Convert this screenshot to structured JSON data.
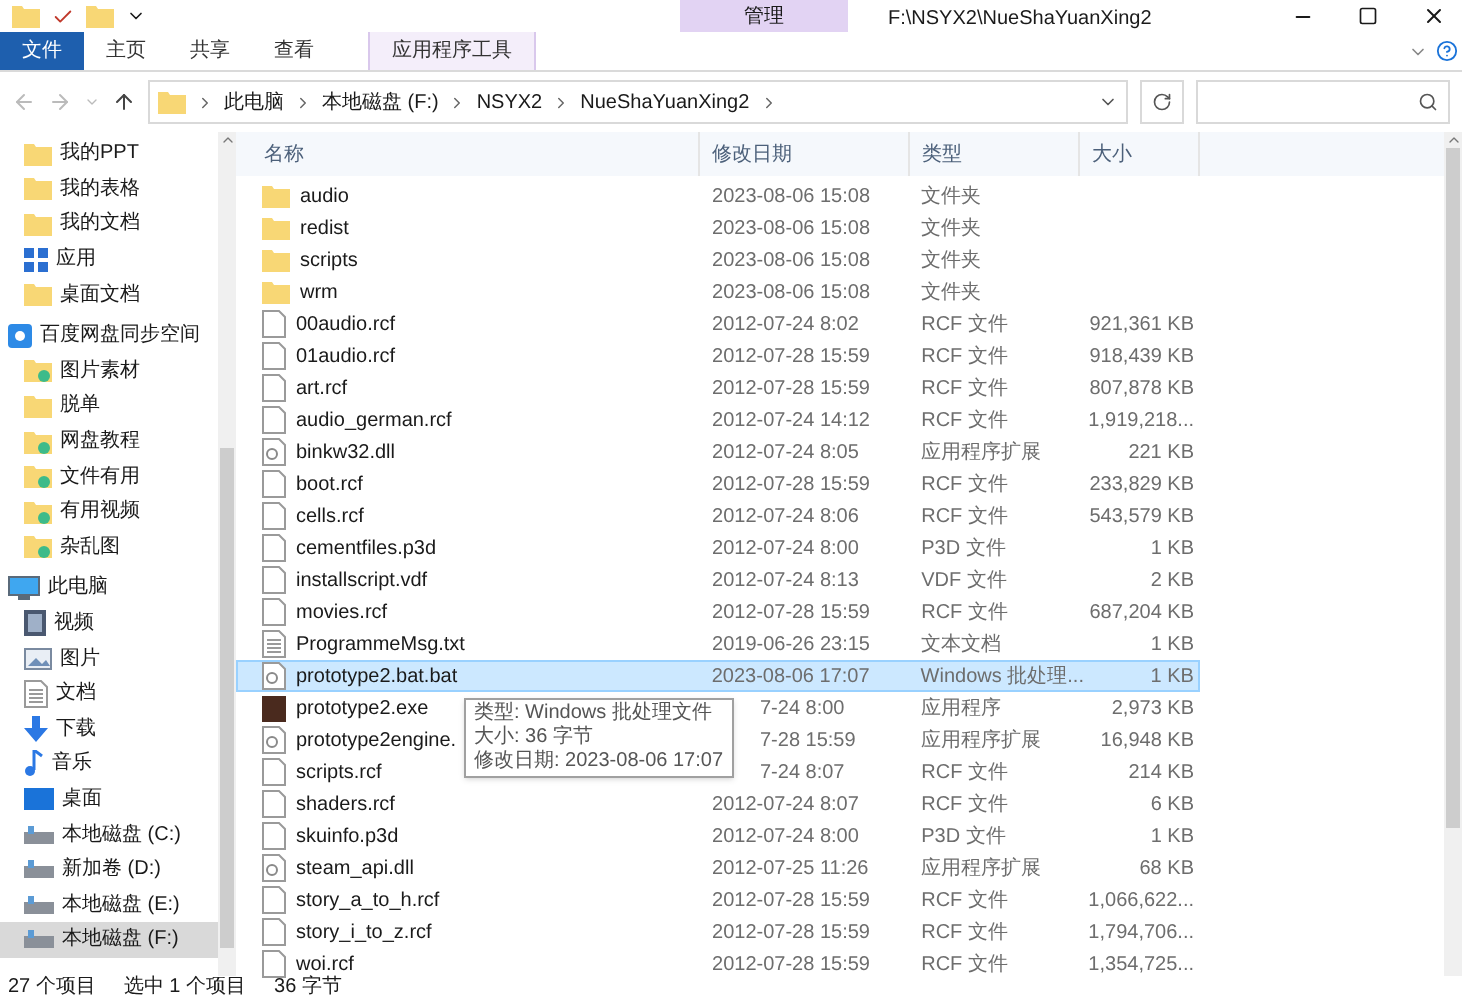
{
  "title_bar": {
    "context_tab": "管理",
    "title": "F:\\NSYX2\\NueShaYuanXing2"
  },
  "ribbon_tabs": [
    {
      "label": "文件",
      "kind": "file"
    },
    {
      "label": "主页",
      "kind": "plain"
    },
    {
      "label": "共享",
      "kind": "plain"
    },
    {
      "label": "查看",
      "kind": "plain"
    },
    {
      "label": "应用程序工具",
      "kind": "context"
    }
  ],
  "breadcrumb": [
    "此电脑",
    "本地磁盘 (F:)",
    "NSYX2",
    "NueShaYuanXing2"
  ],
  "sidebar": {
    "items": [
      {
        "label": "我的PPT",
        "kind": "folder",
        "selected": false
      },
      {
        "label": "我的表格",
        "kind": "folder",
        "selected": false
      },
      {
        "label": "我的文档",
        "kind": "folder",
        "selected": false
      },
      {
        "label": "应用",
        "kind": "apps",
        "selected": false
      },
      {
        "label": "桌面文档",
        "kind": "folder",
        "selected": false
      },
      {
        "label": "百度网盘同步空间",
        "kind": "cloud",
        "selected": false
      },
      {
        "label": "图片素材",
        "kind": "synced",
        "selected": false
      },
      {
        "label": "脱单",
        "kind": "folder",
        "selected": false
      },
      {
        "label": "网盘教程",
        "kind": "synced",
        "selected": false
      },
      {
        "label": "文件有用",
        "kind": "synced",
        "selected": false
      },
      {
        "label": "有用视频",
        "kind": "synced",
        "selected": false
      },
      {
        "label": "杂乱图",
        "kind": "synced",
        "selected": false
      },
      {
        "label": "此电脑",
        "kind": "pc",
        "selected": false
      },
      {
        "label": "视频",
        "kind": "video",
        "selected": false
      },
      {
        "label": "图片",
        "kind": "picture",
        "selected": false
      },
      {
        "label": "文档",
        "kind": "document",
        "selected": false
      },
      {
        "label": "下载",
        "kind": "download",
        "selected": false
      },
      {
        "label": "音乐",
        "kind": "music",
        "selected": false
      },
      {
        "label": "桌面",
        "kind": "desktop",
        "selected": false
      },
      {
        "label": "本地磁盘 (C:)",
        "kind": "drive",
        "selected": false
      },
      {
        "label": "新加卷 (D:)",
        "kind": "drive",
        "selected": false
      },
      {
        "label": "本地磁盘 (E:)",
        "kind": "drive",
        "selected": false
      },
      {
        "label": "本地磁盘 (F:)",
        "kind": "drive",
        "selected": true
      }
    ]
  },
  "table": {
    "columns": [
      "名称",
      "修改日期",
      "类型",
      "大小"
    ],
    "rows": [
      {
        "name": "audio",
        "kind": "folder",
        "date": "2023-08-06 15:08",
        "type": "文件夹",
        "size": "",
        "selected": false
      },
      {
        "name": "redist",
        "kind": "folder",
        "date": "2023-08-06 15:08",
        "type": "文件夹",
        "size": "",
        "selected": false
      },
      {
        "name": "scripts",
        "kind": "folder",
        "date": "2023-08-06 15:08",
        "type": "文件夹",
        "size": "",
        "selected": false
      },
      {
        "name": "wrm",
        "kind": "folder",
        "date": "2023-08-06 15:08",
        "type": "文件夹",
        "size": "",
        "selected": false
      },
      {
        "name": "00audio.rcf",
        "kind": "file",
        "date": "2012-07-24 8:02",
        "type": "RCF 文件",
        "size": "921,361 KB",
        "selected": false
      },
      {
        "name": "01audio.rcf",
        "kind": "file",
        "date": "2012-07-28 15:59",
        "type": "RCF 文件",
        "size": "918,439 KB",
        "selected": false
      },
      {
        "name": "art.rcf",
        "kind": "file",
        "date": "2012-07-28 15:59",
        "type": "RCF 文件",
        "size": "807,878 KB",
        "selected": false
      },
      {
        "name": "audio_german.rcf",
        "kind": "file",
        "date": "2012-07-24 14:12",
        "type": "RCF 文件",
        "size": "1,919,218...",
        "selected": false
      },
      {
        "name": "binkw32.dll",
        "kind": "dll",
        "date": "2012-07-24 8:05",
        "type": "应用程序扩展",
        "size": "221 KB",
        "selected": false
      },
      {
        "name": "boot.rcf",
        "kind": "file",
        "date": "2012-07-28 15:59",
        "type": "RCF 文件",
        "size": "233,829 KB",
        "selected": false
      },
      {
        "name": "cells.rcf",
        "kind": "file",
        "date": "2012-07-24 8:06",
        "type": "RCF 文件",
        "size": "543,579 KB",
        "selected": false
      },
      {
        "name": "cementfiles.p3d",
        "kind": "file",
        "date": "2012-07-24 8:00",
        "type": "P3D 文件",
        "size": "1 KB",
        "selected": false
      },
      {
        "name": "installscript.vdf",
        "kind": "file",
        "date": "2012-07-24 8:13",
        "type": "VDF 文件",
        "size": "2 KB",
        "selected": false
      },
      {
        "name": "movies.rcf",
        "kind": "file",
        "date": "2012-07-28 15:59",
        "type": "RCF 文件",
        "size": "687,204 KB",
        "selected": false
      },
      {
        "name": "ProgrammeMsg.txt",
        "kind": "text",
        "date": "2019-06-26 23:15",
        "type": "文本文档",
        "size": "1 KB",
        "selected": false
      },
      {
        "name": "prototype2.bat.bat",
        "kind": "batch",
        "date": "2023-08-06 17:07",
        "type": "Windows 批处理...",
        "size": "1 KB",
        "selected": true
      },
      {
        "name": "prototype2.exe",
        "kind": "exe",
        "date": "7-24 8:00",
        "type": "应用程序",
        "size": "2,973 KB",
        "selected": false
      },
      {
        "name": "prototype2engine.",
        "kind": "dll",
        "date": "7-28 15:59",
        "type": "应用程序扩展",
        "size": "16,948 KB",
        "selected": false
      },
      {
        "name": "scripts.rcf",
        "kind": "file",
        "date": "7-24 8:07",
        "type": "RCF 文件",
        "size": "214 KB",
        "selected": false
      },
      {
        "name": "shaders.rcf",
        "kind": "file",
        "date": "2012-07-24 8:07",
        "type": "RCF 文件",
        "size": "6 KB",
        "selected": false
      },
      {
        "name": "skuinfo.p3d",
        "kind": "file",
        "date": "2012-07-24 8:00",
        "type": "P3D 文件",
        "size": "1 KB",
        "selected": false
      },
      {
        "name": "steam_api.dll",
        "kind": "dll",
        "date": "2012-07-25 11:26",
        "type": "应用程序扩展",
        "size": "68 KB",
        "selected": false
      },
      {
        "name": "story_a_to_h.rcf",
        "kind": "file",
        "date": "2012-07-28 15:59",
        "type": "RCF 文件",
        "size": "1,066,622...",
        "selected": false
      },
      {
        "name": "story_i_to_z.rcf",
        "kind": "file",
        "date": "2012-07-28 15:59",
        "type": "RCF 文件",
        "size": "1,794,706...",
        "selected": false
      },
      {
        "name": "woi.rcf",
        "kind": "file",
        "date": "2012-07-28 15:59",
        "type": "RCF 文件",
        "size": "1,354,725...",
        "selected": false
      }
    ]
  },
  "tooltip": {
    "lines": [
      "类型: Windows 批处理文件",
      "大小: 36 字节",
      "修改日期: 2023-08-06 17:07"
    ]
  },
  "status_bar": [
    "27 个项目",
    "选中 1 个项目",
    "36 字节"
  ]
}
